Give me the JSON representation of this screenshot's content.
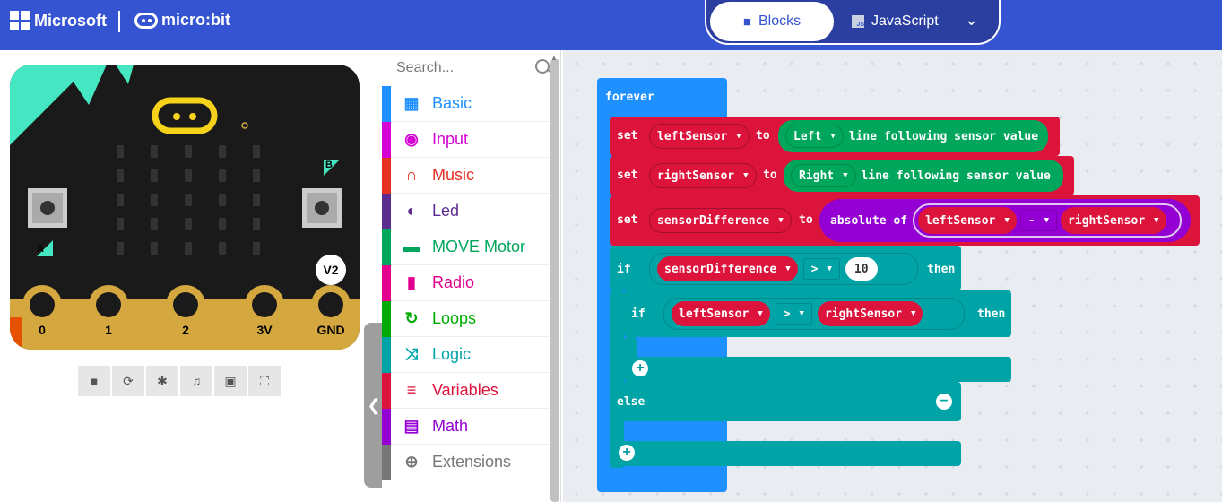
{
  "header": {
    "ms_label": "Microsoft",
    "mb_label": "micro:bit",
    "tab_blocks": "Blocks",
    "tab_js": "JavaScript",
    "js_badge": "JS"
  },
  "simulator": {
    "pins": [
      "0",
      "1",
      "2",
      "3V",
      "GND"
    ],
    "badge": "V2",
    "btn_a": "A",
    "btn_b": "B"
  },
  "toolbox": {
    "search_placeholder": "Search...",
    "categories": [
      {
        "label": "Basic",
        "color": "#1e90ff",
        "icon": "grid-icon"
      },
      {
        "label": "Input",
        "color": "#d400d4",
        "icon": "input-icon"
      },
      {
        "label": "Music",
        "color": "#e63022",
        "icon": "headphones-icon"
      },
      {
        "label": "Led",
        "color": "#5c2d91",
        "icon": "toggle-icon"
      },
      {
        "label": "MOVE Motor",
        "color": "#00a65c",
        "icon": "car-icon"
      },
      {
        "label": "Radio",
        "color": "#e3008c",
        "icon": "signal-icon"
      },
      {
        "label": "Loops",
        "color": "#00aa00",
        "icon": "loop-icon"
      },
      {
        "label": "Logic",
        "color": "#00a4a6",
        "icon": "shuffle-icon"
      },
      {
        "label": "Variables",
        "color": "#dc143c",
        "icon": "list-icon"
      },
      {
        "label": "Math",
        "color": "#9400d3",
        "icon": "calculator-icon"
      },
      {
        "label": "Extensions",
        "color": "#777777",
        "icon": "plus-circle-icon"
      }
    ]
  },
  "code": {
    "forever": "forever",
    "set": "set",
    "to": "to",
    "var_left": "leftSensor",
    "var_right": "rightSensor",
    "var_diff": "sensorDifference",
    "opt_left": "Left",
    "opt_right": "Right",
    "sensor_text": "line following sensor value",
    "abs_text": "absolute of",
    "minus": "-",
    "gt": ">",
    "num": "10",
    "if": "if",
    "then": "then",
    "else": "else"
  },
  "colors": {
    "header": "#3454d1",
    "forever": "#1e90ff",
    "variable": "#dc143c",
    "sensor": "#00a65c",
    "math": "#9400d3",
    "logic": "#00a4a6"
  }
}
